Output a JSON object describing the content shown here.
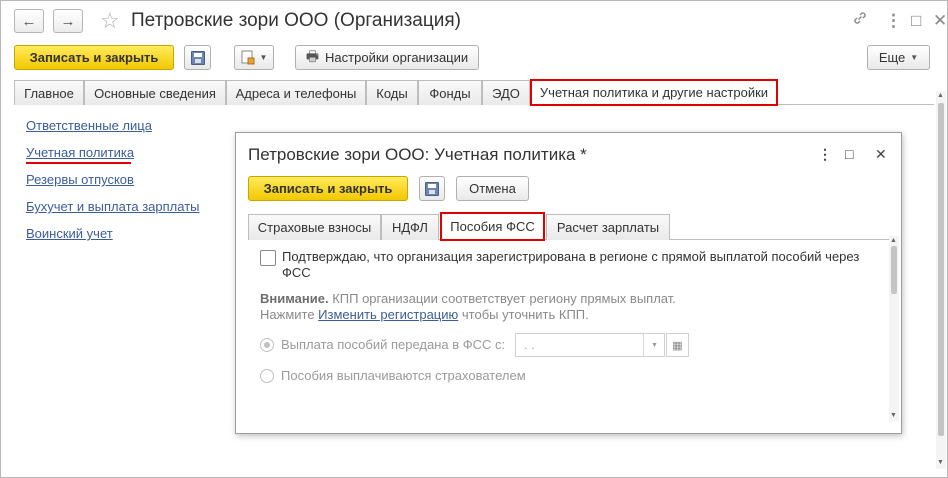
{
  "window": {
    "title": "Петровские зори ООО (Организация)",
    "back_icon": "←",
    "forward_icon": "→",
    "star_icon": "☆",
    "link_icon": "🔗",
    "menu_icon": "⋮",
    "maximize_icon": "□",
    "close_icon": "✕"
  },
  "toolbar": {
    "save_close_label": "Записать и закрыть",
    "settings_label": "Настройки организации",
    "more_label": "Еще",
    "caret": "▼"
  },
  "tabs": [
    {
      "label": "Главное"
    },
    {
      "label": "Основные сведения"
    },
    {
      "label": "Адреса и телефоны"
    },
    {
      "label": "Коды"
    },
    {
      "label": "Фонды"
    },
    {
      "label": "ЭДО"
    },
    {
      "label": "Учетная политика и другие настройки",
      "active": true
    }
  ],
  "sidebar": {
    "links": [
      {
        "label": "Ответственные лица"
      },
      {
        "label": "Учетная политика"
      },
      {
        "label": "Резервы отпусков"
      },
      {
        "label": "Бухучет и выплата зарплаты"
      },
      {
        "label": "Воинский учет"
      }
    ]
  },
  "dialog": {
    "title": "Петровские зори ООО: Учетная политика *",
    "menu_icon": "⋮",
    "maximize_icon": "□",
    "close_icon": "✕",
    "save_close_label": "Записать и закрыть",
    "cancel_label": "Отмена",
    "tabs": [
      {
        "label": "Страховые взносы"
      },
      {
        "label": "НДФЛ"
      },
      {
        "label": "Пособия ФСС",
        "active": true
      },
      {
        "label": "Расчет зарплаты"
      }
    ],
    "checkbox_label": "Подтверждаю, что организация зарегистрирована в регионе с прямой выплатой пособий через ФСС",
    "checkbox_checked": false,
    "warning_bold": "Внимание.",
    "warning_text": " КПП организации соответствует региону прямых выплат.",
    "hint_prefix": "Нажмите ",
    "hint_link": "Изменить регистрацию",
    "hint_suffix": " чтобы уточнить КПП.",
    "radio1_label": "Выплата пособий передана в ФСС с:",
    "radio2_label": "Пособия выплачиваются страхователем",
    "date_value": ". .",
    "calendar_icon": "▦"
  }
}
